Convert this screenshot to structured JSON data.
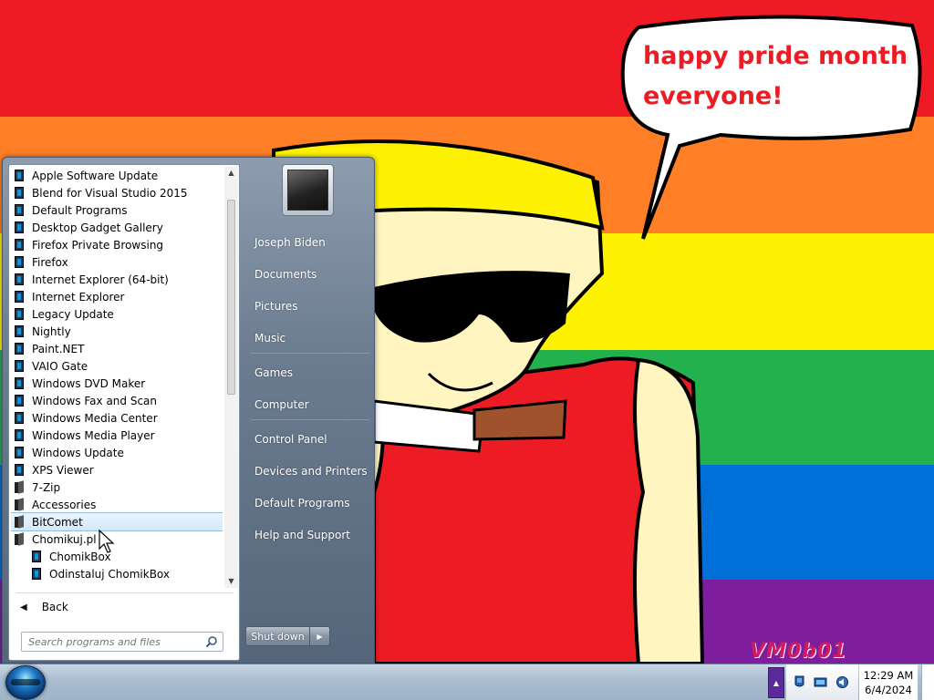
{
  "desktop": {
    "speech_lines": [
      "happy pride month",
      "everyone!"
    ],
    "watermark": "VM0b01",
    "flag_colors": [
      "#ee1b24",
      "#ff7f27",
      "#fff200",
      "#22b14c",
      "#0070d8",
      "#7f1d9f"
    ]
  },
  "start_menu": {
    "programs": [
      {
        "label": "Apple Software Update",
        "kind": "program"
      },
      {
        "label": "Blend for Visual Studio 2015",
        "kind": "program"
      },
      {
        "label": "Default Programs",
        "kind": "program"
      },
      {
        "label": "Desktop Gadget Gallery",
        "kind": "program"
      },
      {
        "label": "Firefox Private Browsing",
        "kind": "program"
      },
      {
        "label": "Firefox",
        "kind": "program"
      },
      {
        "label": "Internet Explorer (64-bit)",
        "kind": "program"
      },
      {
        "label": "Internet Explorer",
        "kind": "program"
      },
      {
        "label": "Legacy Update",
        "kind": "program"
      },
      {
        "label": "Nightly",
        "kind": "program"
      },
      {
        "label": "Paint.NET",
        "kind": "program"
      },
      {
        "label": "VAIO Gate",
        "kind": "program"
      },
      {
        "label": "Windows DVD Maker",
        "kind": "program"
      },
      {
        "label": "Windows Fax and Scan",
        "kind": "program"
      },
      {
        "label": "Windows Media Center",
        "kind": "program"
      },
      {
        "label": "Windows Media Player",
        "kind": "program"
      },
      {
        "label": "Windows Update",
        "kind": "program"
      },
      {
        "label": "XPS Viewer",
        "kind": "program"
      },
      {
        "label": "7-Zip",
        "kind": "folder"
      },
      {
        "label": "Accessories",
        "kind": "folder"
      },
      {
        "label": "BitComet",
        "kind": "folder",
        "highlighted": true
      },
      {
        "label": "Chomikuj.pl",
        "kind": "folder"
      },
      {
        "label": "ChomikBox",
        "kind": "program",
        "sub": true
      },
      {
        "label": "Odinstaluj ChomikBox",
        "kind": "program",
        "sub": true
      }
    ],
    "back_label": "Back",
    "search_placeholder": "Search programs and files",
    "right_items": [
      {
        "label": "Joseph Biden",
        "group": 0
      },
      {
        "label": "Documents",
        "group": 0
      },
      {
        "label": "Pictures",
        "group": 0
      },
      {
        "label": "Music",
        "group": 0
      },
      {
        "label": "Games",
        "group": 1
      },
      {
        "label": "Computer",
        "group": 1
      },
      {
        "label": "Control Panel",
        "group": 2
      },
      {
        "label": "Devices and Printers",
        "group": 2
      },
      {
        "label": "Default Programs",
        "group": 2
      },
      {
        "label": "Help and Support",
        "group": 2
      }
    ],
    "shutdown_label": "Shut down",
    "shutdown_arrow_icon": "chevron-right-icon"
  },
  "taskbar": {
    "start_icon": "windows-orb-icon",
    "clock_time": "12:29 AM",
    "clock_date": "6/4/2024",
    "tray_icons": [
      "action-center-flag-icon",
      "network-icon",
      "volume-icon"
    ],
    "tray_expand_icon": "chevron-up-icon"
  }
}
